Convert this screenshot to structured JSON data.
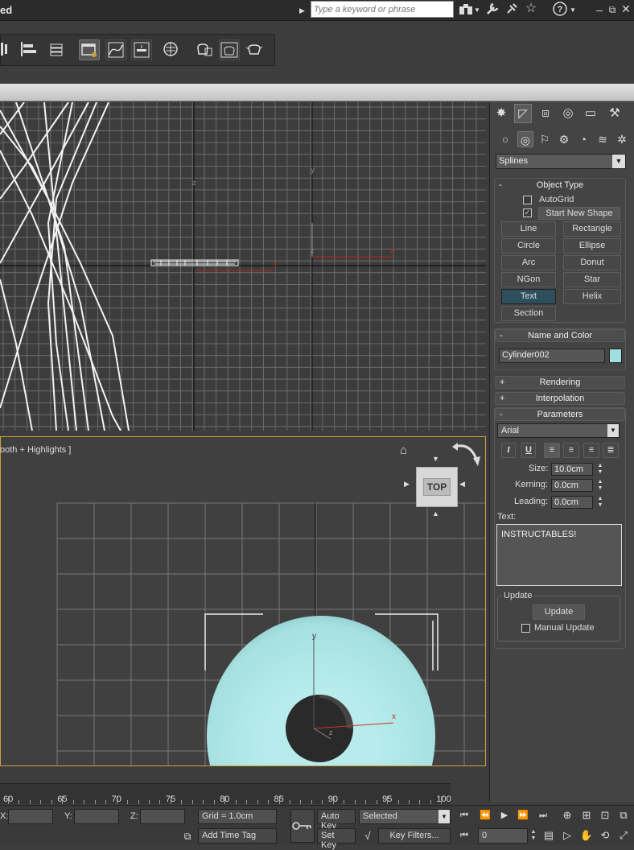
{
  "title": "ed",
  "search": {
    "placeholder": "Type a keyword or phrase"
  },
  "viewport_bottom_label": "ooth + Highlights ]",
  "viewcube_label": "TOP",
  "command_panel": {
    "category": "Splines",
    "object_type": {
      "title": "Object Type",
      "autogrid_label": "AutoGrid",
      "autogrid_checked": false,
      "start_new_shape_label": "Start New Shape",
      "start_new_shape_checked": true,
      "buttons": [
        "Line",
        "Rectangle",
        "Circle",
        "Ellipse",
        "Arc",
        "Donut",
        "NGon",
        "Star",
        "Text",
        "Helix",
        "Section"
      ],
      "active_button": "Text"
    },
    "name_color": {
      "title": "Name and Color",
      "name": "Cylinder002",
      "color": "#9ee0e0"
    },
    "rendering": {
      "title": "Rendering",
      "sign": "+"
    },
    "interpolation": {
      "title": "Interpolation",
      "sign": "+"
    },
    "parameters": {
      "title": "Parameters",
      "sign": "-",
      "font": "Arial",
      "size_label": "Size:",
      "size": "10.0cm",
      "kerning_label": "Kerning:",
      "kerning": "0.0cm",
      "leading_label": "Leading:",
      "leading": "0.0cm",
      "text_label": "Text:",
      "text": "INSTRUCTABLES!",
      "update_group": "Update",
      "update_button": "Update",
      "manual_update_label": "Manual Update",
      "manual_update_checked": false
    },
    "collapse_sign": "-"
  },
  "timeline": {
    "ticks": [
      "60",
      "65",
      "70",
      "75",
      "80",
      "85",
      "90",
      "95",
      "100"
    ]
  },
  "status": {
    "x_label": "X:",
    "y_label": "Y:",
    "z_label": "Z:",
    "grid": "Grid = 1.0cm",
    "add_time_tag": "Add Time Tag",
    "auto_key": "Auto Key",
    "selected": "Selected",
    "set_key": "Set Key",
    "key_filters": "Key Filters...",
    "frame": "0"
  },
  "axis": {
    "x": "x",
    "y": "y",
    "z": "z"
  }
}
